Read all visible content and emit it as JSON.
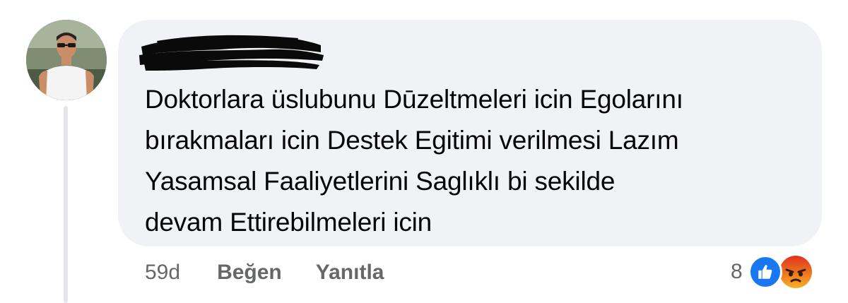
{
  "comment": {
    "author": "",
    "text_lines": [
      "Doktorlara üslubunu Dūzeltmeleri icin Egolarını",
      "bırakmaları icin Destek Egitimi verilmesi Lazım",
      "Yasamsal Faaliyetlerini Saglıklı bi sekilde",
      "devam Ettirebilmeleri icin"
    ],
    "time": "59d",
    "actions": {
      "like": "Beğen",
      "reply": "Yanıtla"
    },
    "reactions": {
      "count": "8",
      "types": [
        "like-icon",
        "angry-icon"
      ]
    }
  },
  "colors": {
    "bubble": "#f0f2f5",
    "text": "#050505",
    "secondary": "#65676b",
    "like_blue": "#1877f2",
    "angry_orange": "#f15a24"
  }
}
